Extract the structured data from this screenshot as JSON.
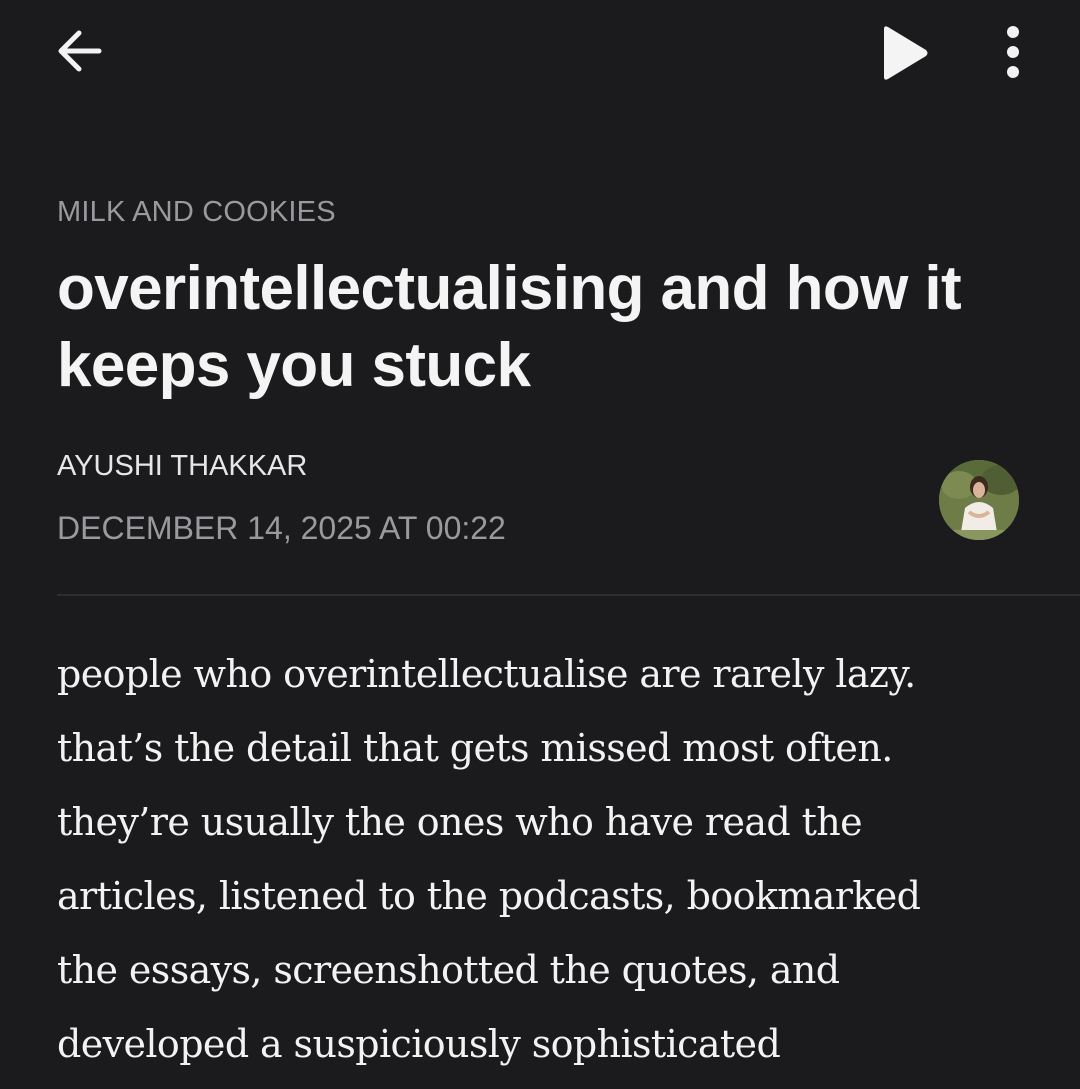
{
  "toolbar": {
    "back_icon": "arrow-left-icon",
    "play_icon": "play-icon",
    "more_icon": "more-vertical-icon"
  },
  "article": {
    "publication": "MILK AND COOKIES",
    "title": "overintellectualising and how it keeps you stuck",
    "author": "AYUSHI THAKKAR",
    "date": "DECEMBER 14, 2025 AT 00:22",
    "body_lines": [
      "people who overintellectualise are rarely lazy.",
      "that’s the detail that gets missed most often.",
      "they’re usually the ones who have read the",
      "articles, listened to the podcasts, bookmarked",
      "the essays, screenshotted the quotes, and",
      "developed a suspiciously sophisticated"
    ]
  },
  "colors": {
    "background": "#1b1b1d",
    "primary_text": "#f2f2f2",
    "muted_text": "#9a9a9e",
    "divider": "#2e2e31"
  }
}
